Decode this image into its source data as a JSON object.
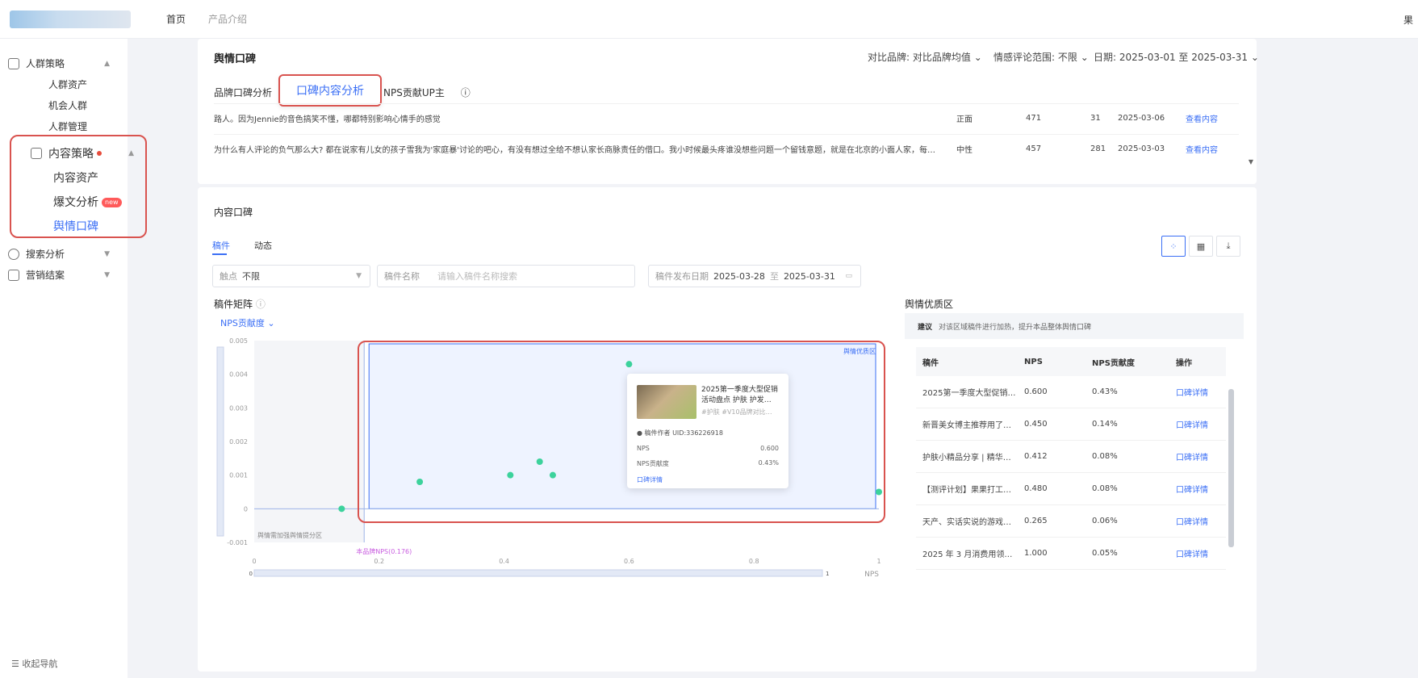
{
  "topnav": {
    "home": "首页",
    "product": "产品介绍",
    "user_initial": "果"
  },
  "sidebar": {
    "groups": [
      {
        "label": "人群策略",
        "children": [
          "人群资产",
          "机会人群",
          "人群管理"
        ]
      },
      {
        "label": "内容策略",
        "children": [
          "内容资产",
          "爆文分析",
          "舆情口碑"
        ],
        "active_child": "舆情口碑",
        "badge": "new"
      },
      {
        "label": "搜索分析"
      },
      {
        "label": "营销结案"
      }
    ],
    "collapse_label": "收起导航"
  },
  "header": {
    "title": "舆情口碑",
    "compare_brand_label": "对比品牌:",
    "compare_brand_value": "对比品牌均值",
    "range_label": "情感评论范围:",
    "range_value": "不限",
    "date_label": "日期:",
    "date_value": "2025-03-01 至 2025-03-31"
  },
  "subtabs": [
    "品牌口碑分析",
    "口碑内容分析",
    "NPS贡献UP主"
  ],
  "active_subtab": "口碑内容分析",
  "posts": [
    {
      "text": "路人。因为Jennie的音色搞笑不懂，哪都特别影响心情手的感觉",
      "sentiment": "正面",
      "count1": "471",
      "count2": "31",
      "date": "2025-03-06",
      "action": "查看内容"
    },
    {
      "text": "为什么有人评论的负气那么大? 都在说家有儿女的孩子雪我为'家庭暴'讨论的吧心，有没有想过全给不想认家长商脉责任的借口。我小时候最头疼谁没想些问题一个留钱意题，就是在北京的小面人家，每一处不…",
      "sentiment": "中性",
      "count1": "457",
      "count2": "281",
      "date": "2025-03-03",
      "action": "查看内容"
    }
  ],
  "content_section": {
    "title": "内容口碑",
    "tabs": [
      "稿件",
      "动态"
    ],
    "active_tab": "稿件",
    "view_icons": [
      "scatter-icon",
      "table-icon",
      "download-icon"
    ],
    "filters": {
      "topic_label": "触点",
      "topic_value": "不限",
      "search_field_label": "稿件名称",
      "search_placeholder": "请输入稿件名称搜索",
      "date_label": "稿件发布日期",
      "date_start": "2025-03-28",
      "date_sep": "至",
      "date_end": "2025-03-31"
    },
    "matrix_title": "稿件矩阵",
    "metric_selector": "NPS贡献度",
    "zone_label": "舆情优质区",
    "low_zone_label": "舆情需加强舆情提分区",
    "avg_marker": "本品牌NPS(0.176)",
    "zoom_left": "0",
    "zoom_right": "1"
  },
  "chart_data": {
    "type": "scatter",
    "xlabel": "NPS",
    "ylabel": "",
    "xlim": [
      0,
      1
    ],
    "ylim": [
      -0.001,
      0.005
    ],
    "xticks": [
      "0",
      "0.2",
      "0.4",
      "0.6",
      "0.8",
      "1"
    ],
    "yticks": [
      "-0.001",
      "0",
      "0.001",
      "0.002",
      "0.003",
      "0.004",
      "0.005"
    ],
    "points": [
      {
        "x": 0.14,
        "y": 0.0
      },
      {
        "x": 0.265,
        "y": 0.0008
      },
      {
        "x": 0.41,
        "y": 0.001
      },
      {
        "x": 0.457,
        "y": 0.0014
      },
      {
        "x": 0.478,
        "y": 0.001
      },
      {
        "x": 0.6,
        "y": 0.0043
      },
      {
        "x": 1.0,
        "y": 0.0005
      }
    ],
    "highlight_color": "#3cd29c"
  },
  "tooltip": {
    "title": "2025第一季度大型促销活动盘点 护肤 护发…",
    "subtitle": "#护肤 #V10品牌对比…",
    "author": "稿件作者 UID:336226918",
    "nps_label": "NPS",
    "nps_value": "0.600",
    "contrib_label": "NPS贡献度",
    "contrib_value": "0.43%",
    "link": "口碑详情"
  },
  "zone": {
    "title": "舆情优质区",
    "note_label": "建议",
    "note_text": "对该区域稿件进行加热，提升本品整体舆情口碑",
    "headers": [
      "稿件",
      "NPS",
      "NPS贡献度",
      "操作"
    ],
    "rows": [
      {
        "name": "2025第一季度大型促销…",
        "nps": "0.600",
        "contrib": "0.43%",
        "action": "口碑详情"
      },
      {
        "name": "新晋美女博主推荐用了…",
        "nps": "0.450",
        "contrib": "0.14%",
        "action": "口碑详情"
      },
      {
        "name": "护肤小精品分享 | 精华…",
        "nps": "0.412",
        "contrib": "0.08%",
        "action": "口碑详情"
      },
      {
        "name": "【测评计划】果果打工…",
        "nps": "0.480",
        "contrib": "0.08%",
        "action": "口碑详情"
      },
      {
        "name": "天产、实话实说的游戏…",
        "nps": "0.265",
        "contrib": "0.06%",
        "action": "口碑详情"
      },
      {
        "name": "2025 年 3 月消费用领…",
        "nps": "1.000",
        "contrib": "0.05%",
        "action": "口碑详情"
      }
    ]
  }
}
